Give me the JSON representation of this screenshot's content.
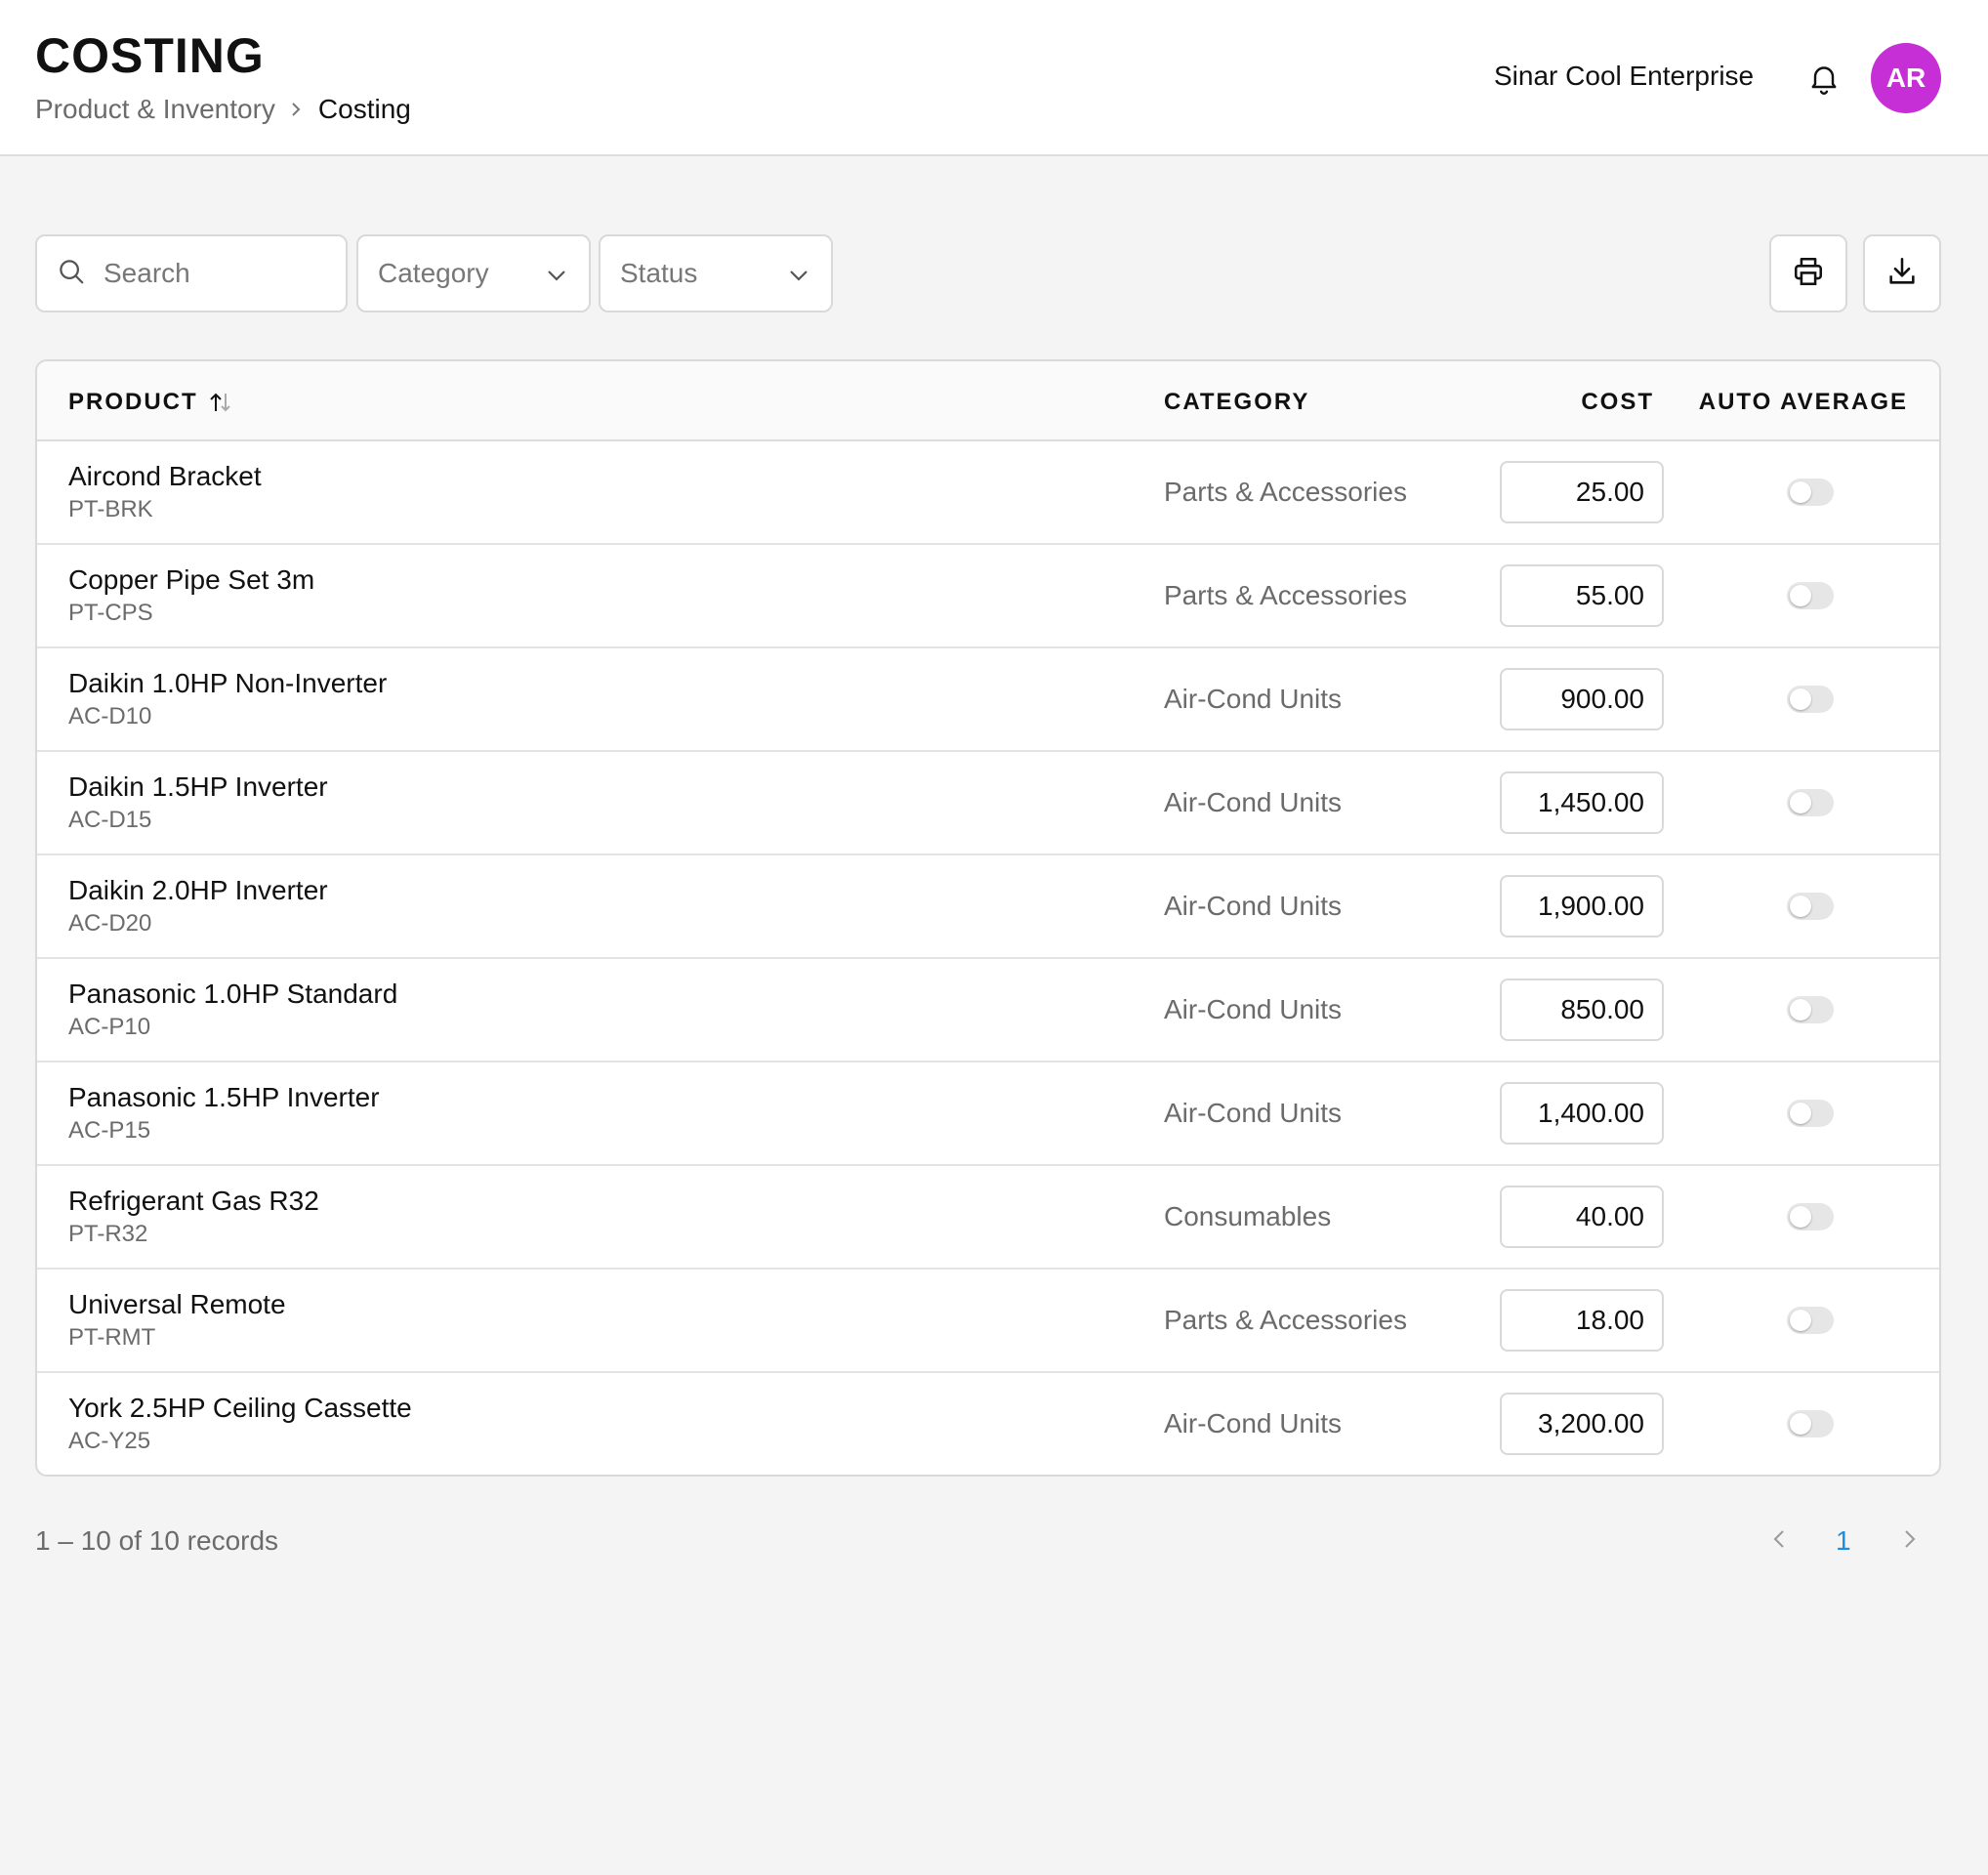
{
  "header": {
    "title": "COSTING",
    "breadcrumb": {
      "parent": "Product & Inventory",
      "current": "Costing"
    },
    "company": "Sinar Cool Enterprise",
    "avatar_initials": "AR",
    "avatar_color": "#c62fd6"
  },
  "filters": {
    "search_placeholder": "Search",
    "category_label": "Category",
    "status_label": "Status"
  },
  "table": {
    "columns": {
      "product": "PRODUCT",
      "category": "CATEGORY",
      "cost": "COST",
      "auto_average": "AUTO AVERAGE"
    },
    "rows": [
      {
        "name": "Aircond Bracket",
        "sku": "PT-BRK",
        "category": "Parts & Accessories",
        "cost": "25.00",
        "auto_average": false
      },
      {
        "name": "Copper Pipe Set 3m",
        "sku": "PT-CPS",
        "category": "Parts & Accessories",
        "cost": "55.00",
        "auto_average": false
      },
      {
        "name": "Daikin 1.0HP Non-Inverter",
        "sku": "AC-D10",
        "category": "Air-Cond Units",
        "cost": "900.00",
        "auto_average": false
      },
      {
        "name": "Daikin 1.5HP Inverter",
        "sku": "AC-D15",
        "category": "Air-Cond Units",
        "cost": "1,450.00",
        "auto_average": false
      },
      {
        "name": "Daikin 2.0HP Inverter",
        "sku": "AC-D20",
        "category": "Air-Cond Units",
        "cost": "1,900.00",
        "auto_average": false
      },
      {
        "name": "Panasonic 1.0HP Standard",
        "sku": "AC-P10",
        "category": "Air-Cond Units",
        "cost": "850.00",
        "auto_average": false
      },
      {
        "name": "Panasonic 1.5HP Inverter",
        "sku": "AC-P15",
        "category": "Air-Cond Units",
        "cost": "1,400.00",
        "auto_average": false
      },
      {
        "name": "Refrigerant Gas R32",
        "sku": "PT-R32",
        "category": "Consumables",
        "cost": "40.00",
        "auto_average": false
      },
      {
        "name": "Universal Remote",
        "sku": "PT-RMT",
        "category": "Parts & Accessories",
        "cost": "18.00",
        "auto_average": false
      },
      {
        "name": "York 2.5HP Ceiling Cassette",
        "sku": "AC-Y25",
        "category": "Air-Cond Units",
        "cost": "3,200.00",
        "auto_average": false
      }
    ]
  },
  "footer": {
    "records_text": "1 – 10 of 10 records",
    "current_page": "1"
  },
  "icons": {
    "bell": "bell-icon",
    "search": "search-icon",
    "chevron": "chevron-down-icon",
    "print": "printer-icon",
    "download": "download-icon",
    "sort": "sort-icon",
    "prev": "chevron-left-icon",
    "next": "chevron-right-icon"
  },
  "colors": {
    "accent": "#1a8fe3",
    "avatar": "#c62fd6"
  }
}
